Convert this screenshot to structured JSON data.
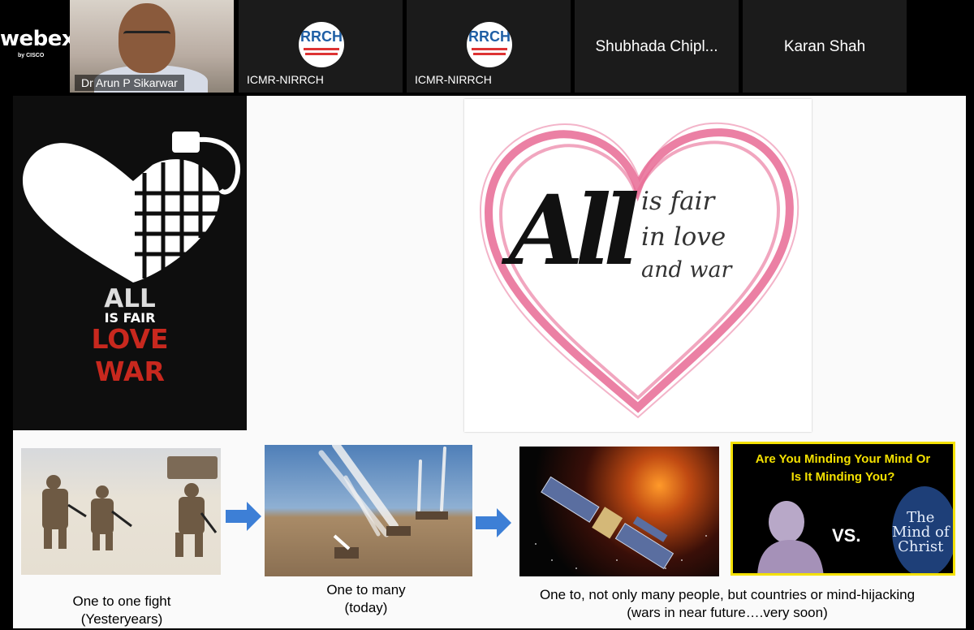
{
  "app": {
    "logo_text": "webex",
    "logo_sub": "by CISCO"
  },
  "participants": [
    {
      "name": "Dr Arun P Sikarwar"
    },
    {
      "name": "ICMR-NIRRCH",
      "logo": "RRCH"
    },
    {
      "name": "ICMR-NIRRCH",
      "logo": "RRCH"
    },
    {
      "name": "Shubhada Chipl..."
    },
    {
      "name": "Karan Shah"
    }
  ],
  "slide": {
    "poster": {
      "line1": "ALL",
      "line2": "IS FAIR",
      "line3": "LOVE",
      "line4": "WAR"
    },
    "heart": {
      "big": "All",
      "line1": "is fair",
      "line2": "in love",
      "line3": "and war"
    },
    "captions": [
      {
        "line1": "One to one fight",
        "line2": "(Yesteryears)"
      },
      {
        "line1": "One to many",
        "line2": "(today)"
      },
      {
        "line1": "One to, not only many people, but countries or mind-hijacking",
        "line2": "(wars in near future….very soon)"
      }
    ],
    "mind_image": {
      "question1": "Are You Minding Your Mind Or",
      "question2": "Is It Minding You?",
      "vs": "VS.",
      "christ1": "The",
      "christ2": "Mind of",
      "christ3": "Christ"
    }
  },
  "colors": {
    "accent_yellow": "#f4e100",
    "heart_pink": "#e86a94",
    "poster_red": "#c8281e",
    "arrow_blue": "#3d7fd6"
  }
}
